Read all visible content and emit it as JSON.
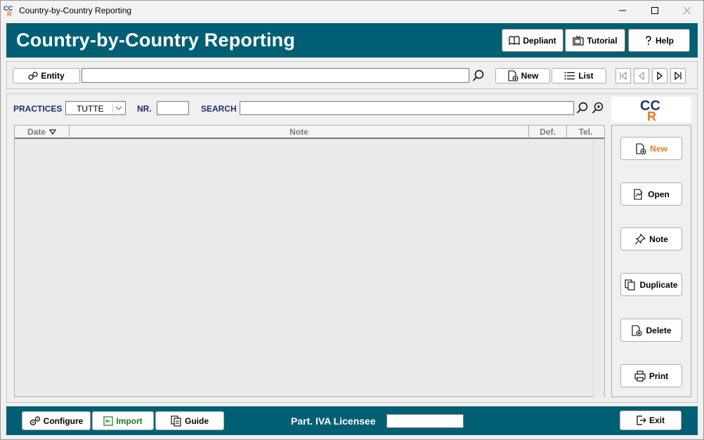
{
  "window": {
    "title": "Country-by-Country Reporting",
    "controls": {
      "minimize": "minimize-icon",
      "maximize": "maximize-icon",
      "close": "close-icon"
    }
  },
  "header": {
    "title": "Country-by-Country Reporting",
    "buttons": {
      "depliant": "Depliant",
      "tutorial": "Tutorial",
      "help": "Help"
    }
  },
  "toolbar": {
    "entity_label": "Entity",
    "entity_value": "",
    "new_label": "New",
    "list_label": "List"
  },
  "filters": {
    "practices_label": "PRACTICES",
    "practices_selected": "TUTTE",
    "nr_label": "NR.",
    "nr_value": "",
    "search_label": "SEARCH",
    "search_value": ""
  },
  "grid": {
    "columns": [
      "Date",
      "Note",
      "Def.",
      "Tel."
    ],
    "rows": []
  },
  "logo": {
    "text_top": "CC",
    "text_bottom": "R",
    "colors": {
      "c": "#1f3a68",
      "r": "#e87722"
    }
  },
  "side_actions": {
    "new": "New",
    "open": "Open",
    "note": "Note",
    "duplicate": "Duplicate",
    "delete": "Delete",
    "print": "Print"
  },
  "footer": {
    "configure": "Configure",
    "import": "Import",
    "guide": "Guide",
    "licensee_label": "Part. IVA Licensee",
    "licensee_value": "",
    "exit": "Exit"
  },
  "colors": {
    "brand": "#005f73",
    "label": "#1f2d7a",
    "accent_new": "#e87722",
    "import": "#1e7a1e"
  }
}
